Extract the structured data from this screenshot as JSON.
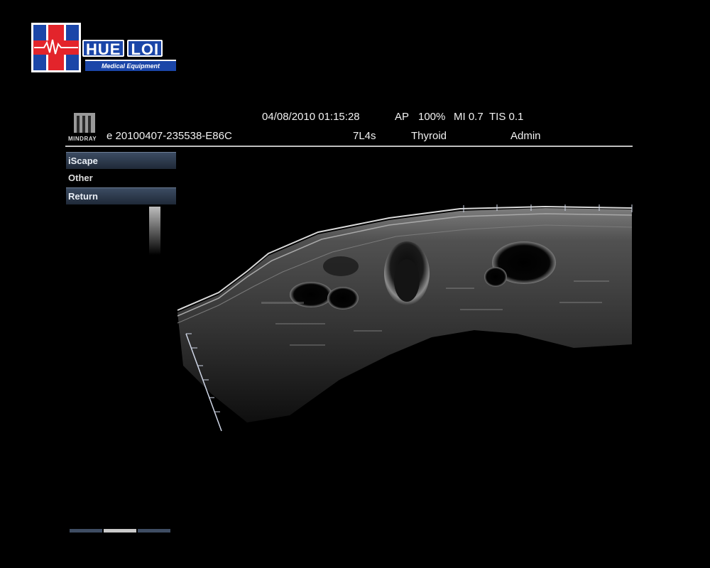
{
  "logo": {
    "word_left": "HUE",
    "word_right": "LOI",
    "tagline": "Medical Equipment"
  },
  "brand": {
    "name": "MINDRAY"
  },
  "header": {
    "datetime": "04/08/2010 01:15:28",
    "ap": "AP",
    "power": "100%",
    "mi": "MI 0.7",
    "tis": "TIS 0.1",
    "patient_id": "e 20100407-235538-E86C",
    "probe": "7L4s",
    "exam": "Thyroid",
    "user": "Admin"
  },
  "menu": {
    "items": [
      {
        "label": "iScape",
        "style": "boxed"
      },
      {
        "label": "Other",
        "style": "plain"
      },
      {
        "label": "Return",
        "style": "boxed"
      }
    ]
  },
  "bottom_tabs": {
    "count": 3,
    "active_index": 1
  },
  "colors": {
    "menu_bg": "#2a3546",
    "logo_blue": "#1b46a8",
    "logo_red": "#e3242b"
  }
}
